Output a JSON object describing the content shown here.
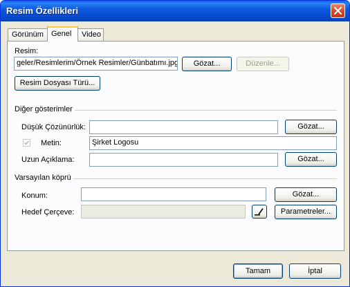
{
  "window": {
    "title": "Resim Özellikleri"
  },
  "tabs": [
    {
      "label": "Görünüm",
      "active": false
    },
    {
      "label": "Genel",
      "active": true
    },
    {
      "label": "Video",
      "active": false
    }
  ],
  "image": {
    "label": "Resim:",
    "path_value": "geler/Resimlerim/Örnek Resimler/Günbatımı.jpg",
    "browse_label": "Gözat...",
    "edit_label": "Düzenle...",
    "file_type_label": "Resim Dosyası Türü..."
  },
  "other_display": {
    "section_title": "Diğer gösterimler",
    "low_res_label": "Düşük Çözünürlük:",
    "low_res_value": "",
    "low_res_browse": "Gözat...",
    "text_label": "Metin:",
    "text_checked": true,
    "text_value": "Şirket Logosu",
    "long_desc_label": "Uzun Açıklama:",
    "long_desc_value": "",
    "long_desc_browse": "Gözat..."
  },
  "default_link": {
    "section_title": "Varsayılan köprü",
    "location_label": "Konum:",
    "location_value": "",
    "location_browse": "Gözat...",
    "target_frame_label": "Hedef Çerçeve:",
    "target_frame_value": "",
    "parameters_label": "Parametreler..."
  },
  "footer": {
    "ok_label": "Tamam",
    "cancel_label": "İptal"
  }
}
